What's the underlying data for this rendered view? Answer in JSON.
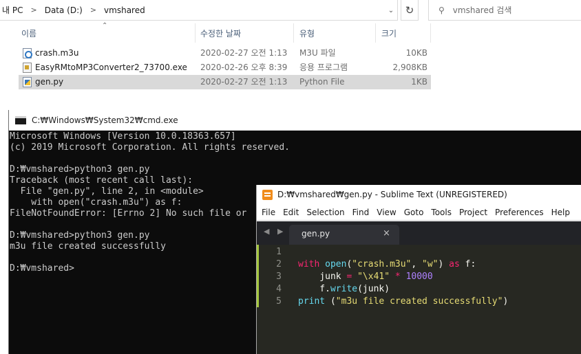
{
  "explorer": {
    "breadcrumb": [
      "내 PC",
      "Data (D:)",
      "vmshared"
    ],
    "search_placeholder": "vmshared 검색",
    "columns": {
      "name": "이름",
      "date": "수정한 날짜",
      "type": "유형",
      "size": "크기"
    },
    "files": [
      {
        "name": "crash.m3u",
        "date": "2020-02-27 오전 1:13",
        "type": "M3U 파일",
        "size": "10KB",
        "icon": "m3u-file-icon"
      },
      {
        "name": "EasyRMtoMP3Converter2_73700.exe",
        "date": "2020-02-26 오후 8:39",
        "type": "응용 프로그램",
        "size": "2,908KB",
        "icon": "exe-file-icon"
      },
      {
        "name": "gen.py",
        "date": "2020-02-27 오전 1:13",
        "type": "Python File",
        "size": "1KB",
        "icon": "python-file-icon",
        "selected": true
      }
    ]
  },
  "cmd": {
    "title": "C:₩Windows₩System32₩cmd.exe",
    "lines": [
      "Microsoft Windows [Version 10.0.18363.657]",
      "(c) 2019 Microsoft Corporation. All rights reserved.",
      "",
      "D:₩vmshared>python3 gen.py",
      "Traceback (most recent call last):",
      "  File \"gen.py\", line 2, in <module>",
      "    with open(\"crash.m3u\") as f:",
      "FileNotFoundError: [Errno 2] No such file or",
      "",
      "D:₩vmshared>python3 gen.py",
      "m3u file created successfully",
      "",
      "D:₩vmshared>"
    ]
  },
  "sublime": {
    "title": "D:₩vmshared₩gen.py - Sublime Text (UNREGISTERED)",
    "menu": [
      "File",
      "Edit",
      "Selection",
      "Find",
      "View",
      "Goto",
      "Tools",
      "Project",
      "Preferences",
      "Help"
    ],
    "tab_label": "gen.py",
    "tab_nav": "◀ ▶",
    "tab_close": "×",
    "line_numbers": [
      "1",
      "2",
      "3",
      "4",
      "5"
    ],
    "code": [
      "",
      "with open(\"crash.m3u\", \"w\") as f:",
      "    junk = \"\\x41\" * 10000",
      "    f.write(junk)",
      "print (\"m3u file created successfully\")"
    ],
    "colors": {
      "keyword": "#f92672",
      "function": "#66d9ef",
      "string": "#e6db74",
      "number": "#ae81ff",
      "background": "#272822"
    }
  }
}
